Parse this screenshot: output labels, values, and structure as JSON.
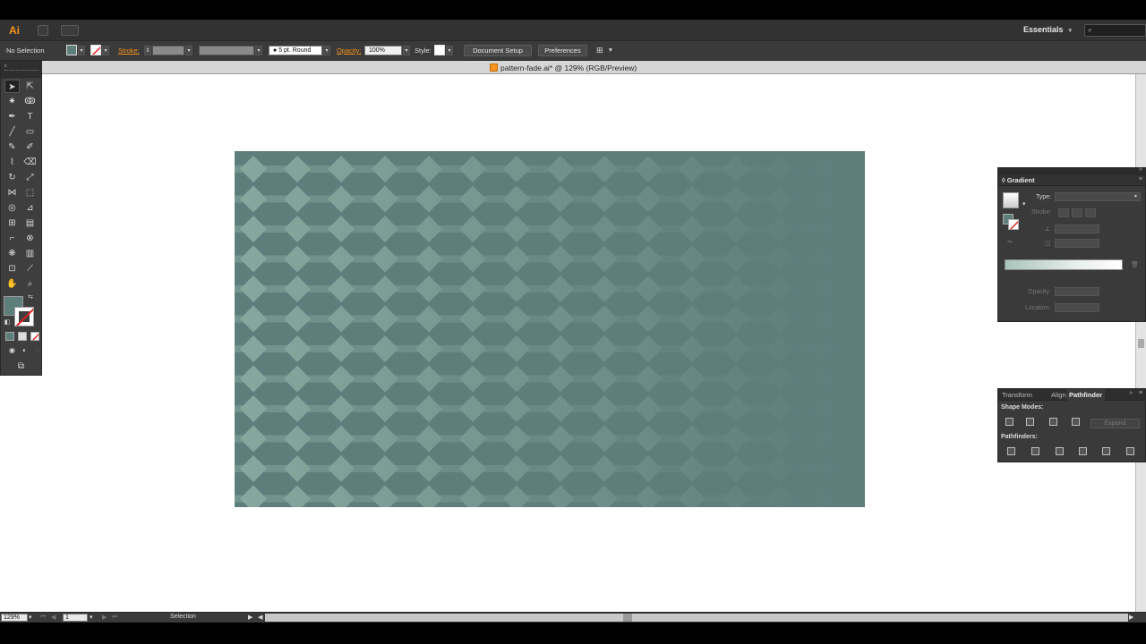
{
  "app": {
    "logo": "Ai",
    "workspace": "Essentials"
  },
  "control_bar": {
    "selection_status": "No Selection",
    "stroke_label": "Stroke:",
    "brush": "5 pt. Round",
    "opacity_label": "Opacity:",
    "opacity_value": "100%",
    "style_label": "Style:",
    "document_setup": "Document Setup",
    "preferences": "Preferences"
  },
  "document": {
    "title": "pattern-fade.ai* @ 129% (RGB/Preview)",
    "artboard_color": "#5e7e7c",
    "pattern_color": "#86a89e"
  },
  "gradient_panel": {
    "title": "Gradient",
    "type_label": "Type:",
    "stroke_label": "Stroke:",
    "opacity_label": "Opacity:",
    "location_label": "Location:"
  },
  "pathfinder_panel": {
    "tabs": [
      "Transform",
      "Align",
      "Pathfinder"
    ],
    "active_tab": "Pathfinder",
    "shape_modes_label": "Shape Modes:",
    "pathfinders_label": "Pathfinders:",
    "expand_label": "Expand"
  },
  "status_bar": {
    "zoom": "129%",
    "artboard_number": "1",
    "current_tool": "Selection"
  }
}
